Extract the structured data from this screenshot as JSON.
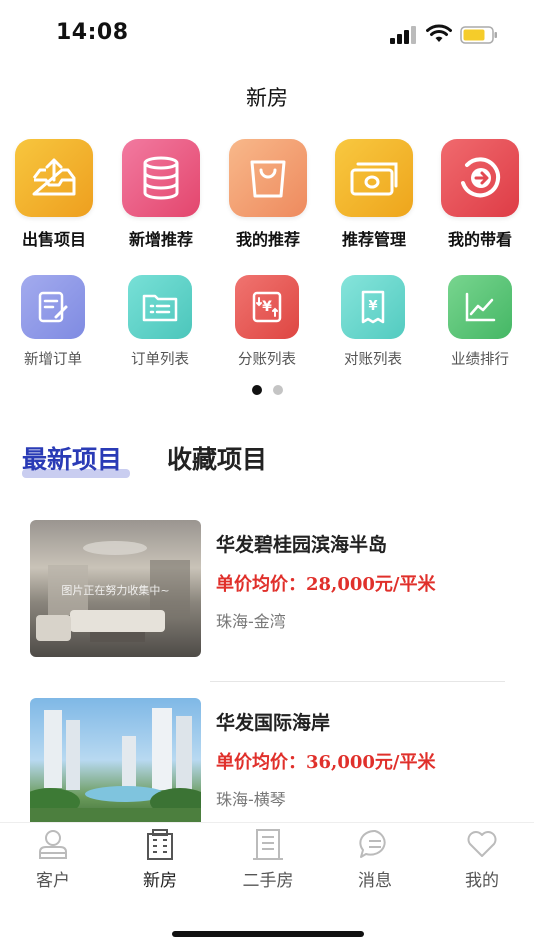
{
  "status": {
    "time": "14:08"
  },
  "header": {
    "title": "新房"
  },
  "primary_actions": [
    {
      "label": "出售项目",
      "icon": "upload-tray-icon",
      "color": "#f2b42c"
    },
    {
      "label": "新增推荐",
      "icon": "database-icon",
      "color": "#ec5d83"
    },
    {
      "label": "我的推荐",
      "icon": "shopping-bag-icon",
      "color": "#f3a072"
    },
    {
      "label": "推荐管理",
      "icon": "money-icon",
      "color": "#f2b62a"
    },
    {
      "label": "我的带看",
      "icon": "arrow-circle-icon",
      "color": "#e9525a"
    }
  ],
  "secondary_actions": [
    {
      "label": "新增订单",
      "icon": "edit-doc-icon",
      "color": "#8f9ae8"
    },
    {
      "label": "订单列表",
      "icon": "folder-list-icon",
      "color": "#5fd1c8"
    },
    {
      "label": "分账列表",
      "icon": "yuan-exchange-icon",
      "color": "#ec5a55"
    },
    {
      "label": "对账列表",
      "icon": "yuan-receipt-icon",
      "color": "#6fd8ce"
    },
    {
      "label": "业绩排行",
      "icon": "trend-chart-icon",
      "color": "#5cc37a"
    }
  ],
  "pager": {
    "active": 1,
    "count": 2
  },
  "sections": {
    "latest": "最新项目",
    "favorites": "收藏项目"
  },
  "projects": [
    {
      "name": "华发碧桂园滨海半岛",
      "price": "单价均价：28,000元/平米",
      "location": "珠海-金湾",
      "image_caption": "图片正在努力收集中~"
    },
    {
      "name": "华发国际海岸",
      "price": "单价均价：36,000元/平米",
      "location": "珠海-横琴"
    }
  ],
  "tabbar": [
    {
      "label": "客户",
      "icon": "customer-icon"
    },
    {
      "label": "新房",
      "icon": "new-house-icon",
      "active": true
    },
    {
      "label": "二手房",
      "icon": "second-hand-house-icon"
    },
    {
      "label": "消息",
      "icon": "message-icon"
    },
    {
      "label": "我的",
      "icon": "heart-icon"
    }
  ],
  "colors": {
    "accent": "#2a3bb6",
    "price": "#e0302b"
  }
}
